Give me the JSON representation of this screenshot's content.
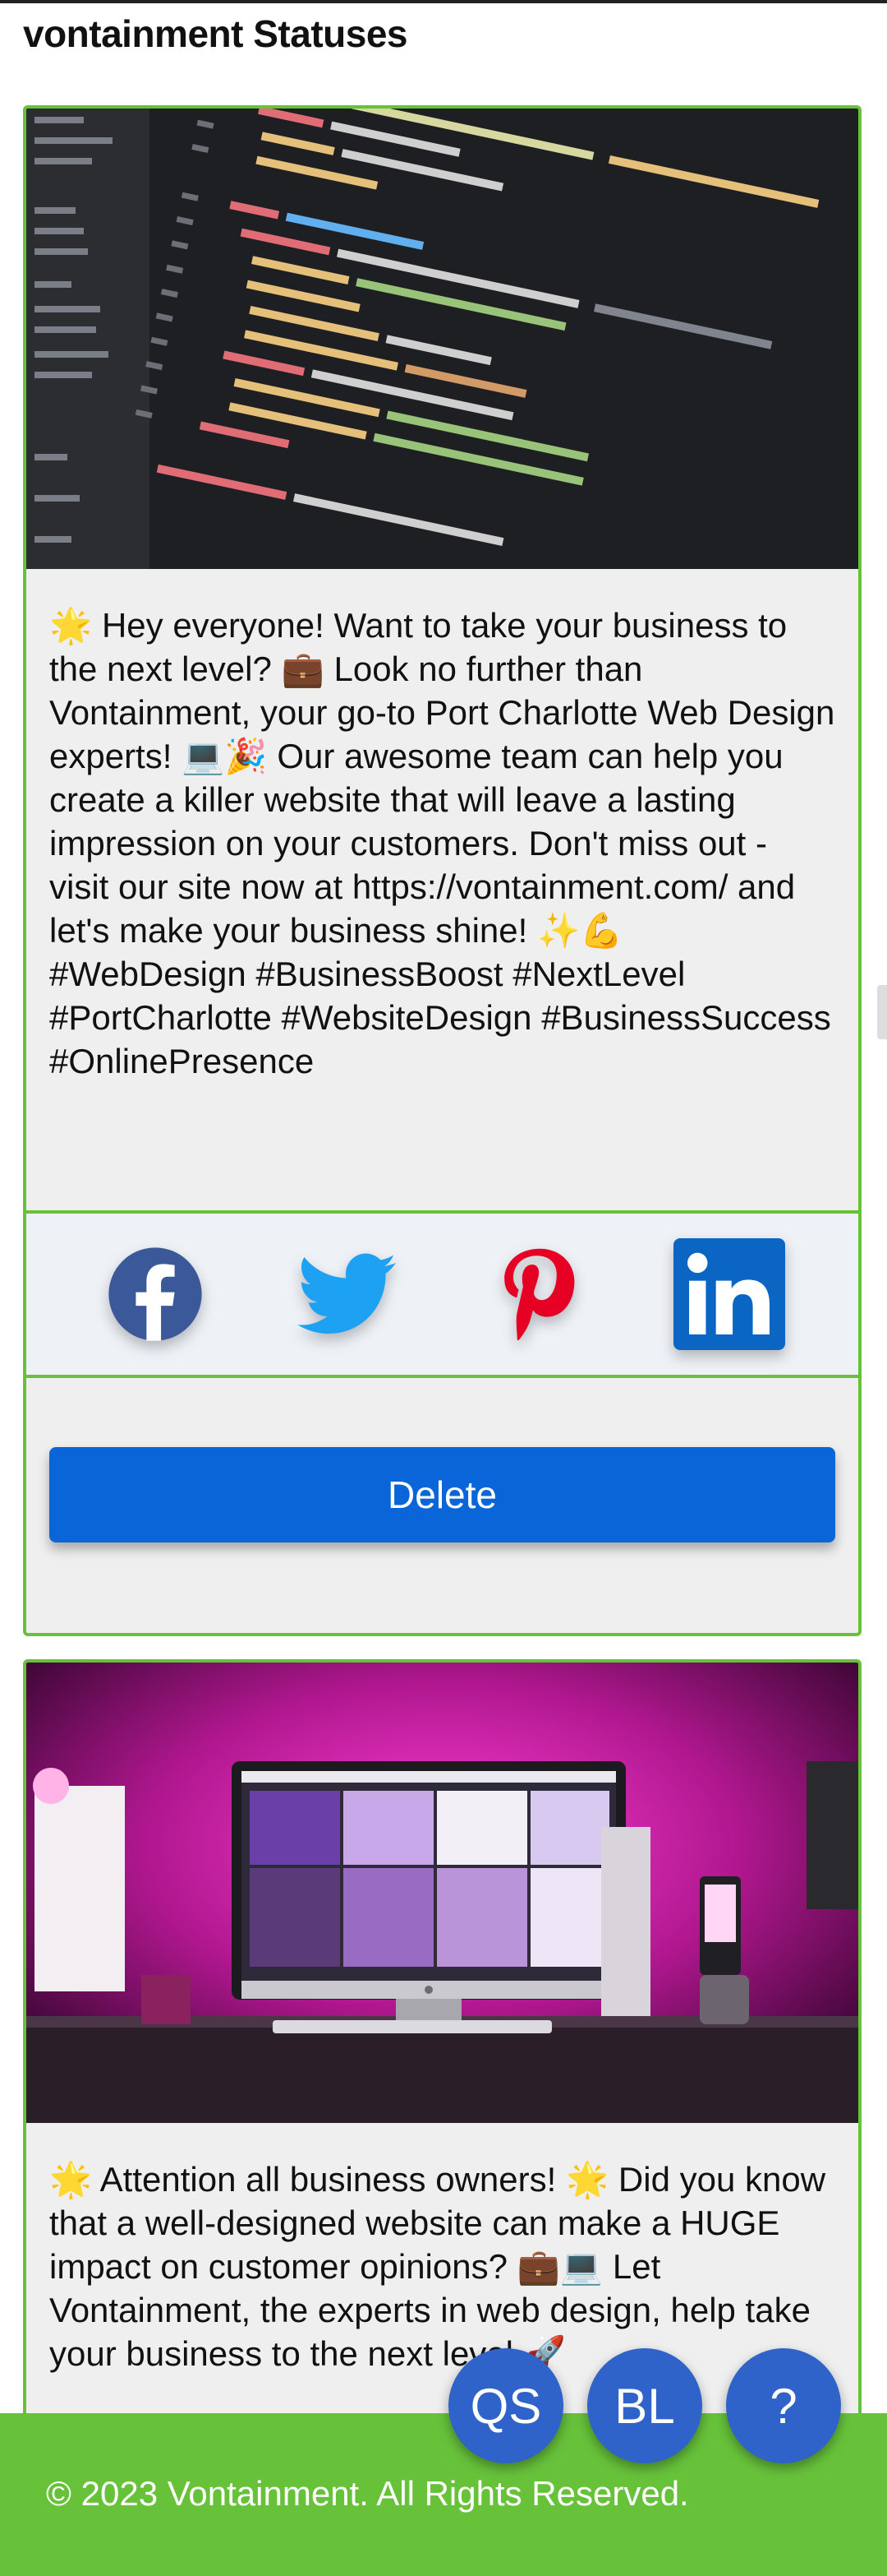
{
  "page": {
    "title": "vontainment Statuses"
  },
  "statuses": [
    {
      "text": "🌟 Hey everyone! Want to take your business to the next level? 💼 Look no further than Vontainment, your go-to Port Charlotte Web Design experts! 💻🎉 Our awesome team can help you create a killer website that will leave a lasting impression on your customers. Don't miss out - visit our site now at https://vontainment.com/ and let's make your business shine! ✨💪  #WebDesign #BusinessBoost #NextLevel #PortCharlotte #WebsiteDesign #BusinessSuccess #OnlinePresence",
      "delete_label": "Delete"
    },
    {
      "text": "🌟 Attention all business owners! 🌟 Did you know that a well-designed website can make a HUGE impact on customer opinions? 💼💻 Let Vontainment, the experts in web design, help take your business to the next level 🚀"
    }
  ],
  "share": {
    "facebook_icon": "facebook-icon",
    "twitter_icon": "twitter-icon",
    "pinterest_icon": "pinterest-icon",
    "linkedin_icon": "linkedin-icon"
  },
  "fabs": {
    "qs": "QS",
    "bl": "BL",
    "help": "?"
  },
  "footer": {
    "text": "© 2023 Vontainment. All Rights Reserved."
  },
  "colors": {
    "accent_green": "#67c23a",
    "delete_blue": "#0a66d8",
    "fab_blue": "#2f63c9",
    "facebook": "#3b5998",
    "twitter": "#1da1f2",
    "pinterest": "#e60023",
    "linkedin": "#0a66c2"
  }
}
